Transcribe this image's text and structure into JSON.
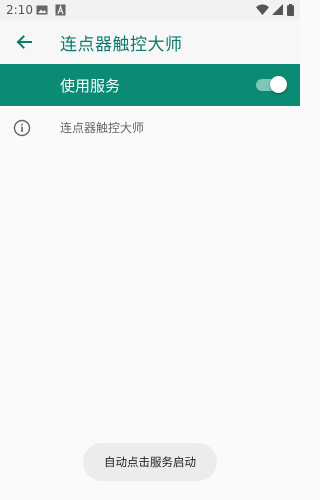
{
  "status_bar": {
    "time": "2:10",
    "left_icons": [
      "gallery-icon",
      "notification-a-icon"
    ],
    "right_icons": [
      "wifi-icon",
      "signal-icon",
      "battery-icon"
    ]
  },
  "app_bar": {
    "back_icon": "arrow-left-icon",
    "title": "连点器触控大师"
  },
  "service": {
    "label": "使用服务",
    "enabled": true
  },
  "info": {
    "icon": "info-icon",
    "text": "连点器触控大师"
  },
  "toast": {
    "text": "自动点击服务启动"
  },
  "colors": {
    "accent": "#0b8a74",
    "title": "#0c7a6b",
    "background": "#fafafa"
  }
}
